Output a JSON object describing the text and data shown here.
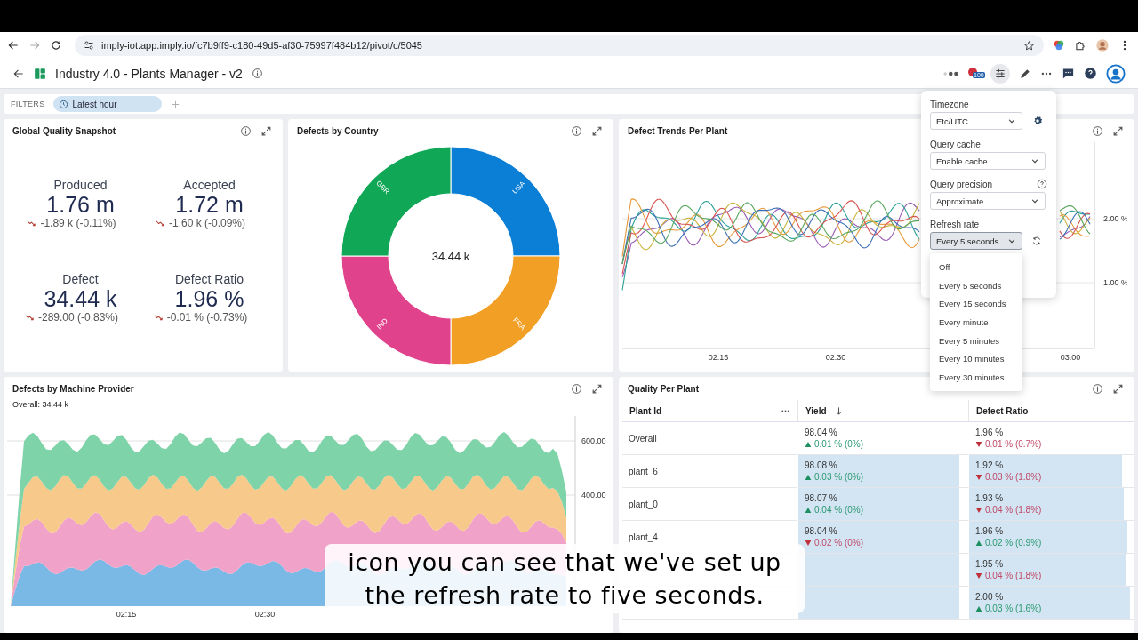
{
  "browser": {
    "url": "imply-iot.app.imply.io/fc7b9ff9-c180-49d5-af30-75997f484b12/pivot/c/5045",
    "forward_disabled": true
  },
  "header": {
    "title": "Industry 4.0 - Plants Manager - v2",
    "badge": "100"
  },
  "filters": {
    "label": "FILTERS",
    "chips": [
      "Latest hour"
    ]
  },
  "snapshot": {
    "title": "Global Quality Snapshot",
    "kpis": [
      {
        "label": "Produced",
        "value": "1.76 m",
        "change": "-1.89 k (-0.11%)",
        "falling": true
      },
      {
        "label": "Accepted",
        "value": "1.72 m",
        "change": "-1.60 k (-0.09%)",
        "falling": true
      },
      {
        "label": "Defect",
        "value": "34.44 k",
        "change": "-289.00 (-0.83%)",
        "falling": true
      },
      {
        "label": "Defect Ratio",
        "value": "1.96 %",
        "change": "-0.01 % (-0.73%)",
        "falling": true
      }
    ]
  },
  "country": {
    "title": "Defects by Country",
    "total": "34.44 k",
    "slices": [
      {
        "label": "USA",
        "color": "#0b7fd6"
      },
      {
        "label": "FRA",
        "color": "#f29f25"
      },
      {
        "label": "IND",
        "color": "#e0428b"
      },
      {
        "label": "GBR",
        "color": "#10a757"
      }
    ]
  },
  "trends": {
    "title": "Defect Trends Per Plant",
    "y_ticks": [
      "2.00 %",
      "1.00 %"
    ],
    "x_ticks": [
      "02:15",
      "02:30",
      "03:00"
    ]
  },
  "machine": {
    "title": "Defects by Machine Provider",
    "overall": "Overall: 34.44 k",
    "y_ticks": [
      "600.00",
      "400.00"
    ],
    "x_ticks": [
      "02:15",
      "02:30"
    ],
    "layers": [
      {
        "color": "#7ab8e6"
      },
      {
        "color": "#f0a2c8"
      },
      {
        "color": "#f7c98a"
      },
      {
        "color": "#7fd3a8"
      }
    ]
  },
  "quality": {
    "title": "Quality Per Plant",
    "columns": [
      {
        "label": "Plant Id",
        "kind": "menu"
      },
      {
        "label": "Yield",
        "kind": "sorted"
      },
      {
        "label": "Defect Ratio",
        "kind": "plain"
      }
    ],
    "rows": [
      {
        "plant": "Overall",
        "yield": {
          "value": "98.04 %",
          "change": "0.01 % (0%)",
          "rising": true
        },
        "defect": {
          "value": "1.96 %",
          "change": "0.01 % (0.7%)",
          "rising": false
        }
      },
      {
        "plant": "plant_6",
        "yield": {
          "value": "98.08 %",
          "change": "0.03 % (0%)",
          "rising": true,
          "level": 0.95
        },
        "defect": {
          "value": "1.92 %",
          "change": "0.03 % (1.8%)",
          "rising": false,
          "level": 0.93
        }
      },
      {
        "plant": "plant_0",
        "yield": {
          "value": "98.07 %",
          "change": "0.04 % (0%)",
          "rising": true,
          "level": 0.95
        },
        "defect": {
          "value": "1.93 %",
          "change": "0.04 % (1.8%)",
          "rising": false,
          "level": 0.94
        }
      },
      {
        "plant": "plant_4",
        "yield": {
          "value": "98.04 %",
          "change": "0.02 % (0%)",
          "rising": false,
          "level": 0.95
        },
        "defect": {
          "value": "1.96 %",
          "change": "0.02 % (0.9%)",
          "rising": true,
          "level": 0.96
        }
      },
      {
        "yield": {
          "level": 0.95
        },
        "defect": {
          "value": "1.95 %",
          "change": "0.04 % (1.8%)",
          "rising": false,
          "level": 0.95
        }
      },
      {
        "yield": {
          "level": 0.95
        },
        "defect": {
          "value": "2.00 %",
          "change": "0.03 % (1.6%)",
          "rising": true,
          "level": 0.98
        }
      }
    ]
  },
  "settings": {
    "fields": [
      {
        "label": "Timezone",
        "value": "Etc/UTC",
        "kind": "gear",
        "open": false
      },
      {
        "label": "Query cache",
        "value": "Enable cache",
        "kind": "plain",
        "open": false
      },
      {
        "label": "Query precision",
        "value": "Approximate",
        "kind": "help",
        "open": false
      },
      {
        "label": "Refresh rate",
        "value": "Every 5 seconds",
        "kind": "refresh",
        "open": true
      }
    ],
    "options": [
      "Off",
      "Every 5 seconds",
      "Every 15 seconds",
      "Every minute",
      "Every 5 minutes",
      "Every 10 minutes",
      "Every 30 minutes"
    ]
  },
  "caption": {
    "lines": [
      "icon you can see that we've set up",
      "the refresh rate to five seconds."
    ]
  }
}
